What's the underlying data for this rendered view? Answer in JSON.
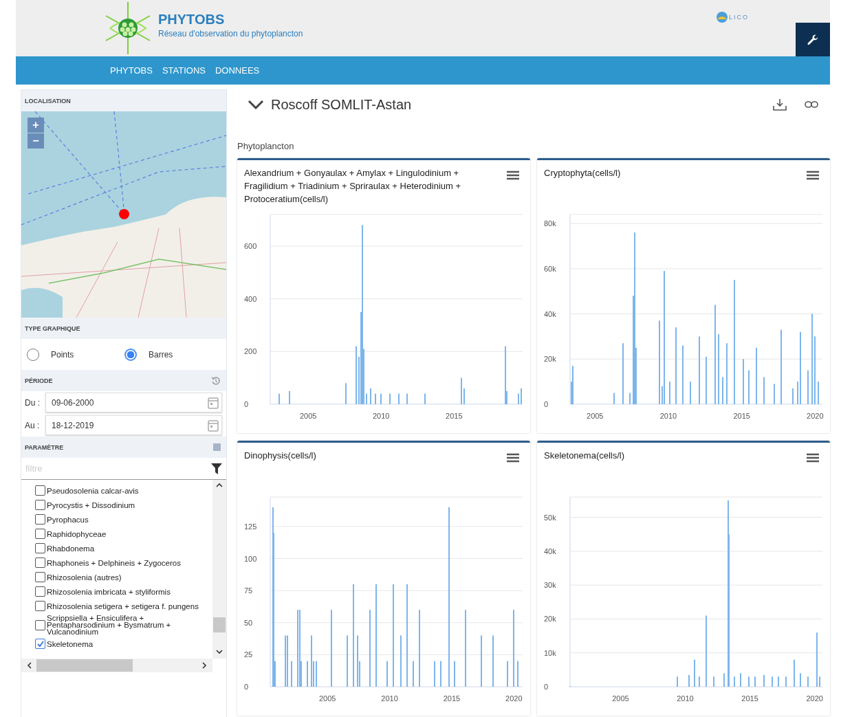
{
  "header": {
    "title": "PHYTOBS",
    "subtitle": "Réseau d'observation du phytoplancton",
    "partner_logo_text": "LICO"
  },
  "nav": [
    "PHYTOBS",
    "STATIONS",
    "DONNEES"
  ],
  "sidebar": {
    "location": {
      "heading": "LOCALISATION",
      "zoom_in": "+",
      "zoom_out": "−"
    },
    "chart_type": {
      "heading": "TYPE GRAPHIQUE",
      "options": [
        {
          "label": "Points",
          "selected": false
        },
        {
          "label": "Barres",
          "selected": true
        }
      ]
    },
    "period": {
      "heading": "PÉRIODE",
      "from": {
        "label": "Du :",
        "value": "09-06-2000"
      },
      "to": {
        "label": "Au :",
        "value": "18-12-2019"
      }
    },
    "parameter": {
      "heading": "PARAMÈTRE",
      "filter_placeholder": "filtre",
      "items": [
        {
          "label": "Pseudosolenia calcar-avis",
          "checked": false
        },
        {
          "label": "Pyrocystis + Dissodinium",
          "checked": false
        },
        {
          "label": "Pyrophacus",
          "checked": false
        },
        {
          "label": "Raphidophyceae",
          "checked": false
        },
        {
          "label": "Rhabdonema",
          "checked": false
        },
        {
          "label": "Rhaphoneis + Delphineis + Zygoceros",
          "checked": false
        },
        {
          "label": "Rhizosolenia (autres)",
          "checked": false
        },
        {
          "label": "Rhizosolenia imbricata + styliformis",
          "checked": false
        },
        {
          "label": "Rhizosolenia setigera + setigera f. pungens",
          "checked": false
        },
        {
          "label": "Scrippsiella + Ensiculifera + Pentapharsodinium + Bysmatrum + Vulcanodinium",
          "checked": false
        },
        {
          "label": "Skeletonema",
          "checked": true
        }
      ]
    }
  },
  "station": {
    "title": "Roscoff SOMLIT-Astan"
  },
  "section": "Phytoplancton",
  "charts": [
    {
      "title": "Alexandrium + Gonyaulax + Amylax + Lingulodinium + Fragilidium + Triadinium + Spriraulax + Heterodinium + Protoceratium(cells/l)",
      "chart_data": {
        "type": "bar",
        "x": [
          2003.0,
          2003.7,
          2007.6,
          2008.3,
          2008.5,
          2008.6,
          2008.7,
          2008.8,
          2009.0,
          2009.3,
          2009.6,
          2010.0,
          2010.6,
          2011.2,
          2011.8,
          2013.0,
          2015.5,
          2015.7,
          2018.5,
          2018.6,
          2019.4,
          2019.6
        ],
        "values": [
          40,
          50,
          80,
          220,
          180,
          350,
          680,
          210,
          40,
          60,
          40,
          40,
          40,
          40,
          40,
          40,
          100,
          60,
          220,
          50,
          40,
          60
        ],
        "xlim": [
          2002.4,
          2019.7
        ],
        "ylim": [
          0,
          720
        ],
        "grid": true,
        "xticks": [
          2005,
          2010,
          2015
        ],
        "yticks": [
          0,
          200,
          400,
          600
        ]
      }
    },
    {
      "title": "Cryptophyta(cells/l)",
      "chart_data": {
        "type": "bar",
        "x": [
          2003.4,
          2003.5,
          2006.3,
          2006.9,
          2007.4,
          2007.6,
          2007.7,
          2007.8,
          2009.4,
          2009.6,
          2009.7,
          2010.1,
          2010.5,
          2011.0,
          2011.5,
          2012.1,
          2012.6,
          2013.2,
          2013.4,
          2013.7,
          2014.0,
          2014.5,
          2015.1,
          2015.5,
          2016.0,
          2016.5,
          2017.2,
          2017.7,
          2018.5,
          2018.8,
          2019.0,
          2019.5,
          2019.8,
          2020.0,
          2020.2
        ],
        "values": [
          10000,
          17000,
          5000,
          27000,
          5000,
          48000,
          76000,
          25000,
          37000,
          8000,
          59000,
          10000,
          34000,
          26000,
          10000,
          30000,
          21000,
          44000,
          31000,
          12000,
          27000,
          55000,
          20000,
          15000,
          25000,
          12000,
          9000,
          33000,
          7000,
          10000,
          32000,
          15000,
          40000,
          30000,
          10000
        ],
        "xlim": [
          2003.3,
          2020.5
        ],
        "ylim": [
          0,
          84000
        ],
        "grid": true,
        "xticks": [
          2005,
          2010,
          2015,
          2020
        ],
        "yticks": [
          {
            "value": 0,
            "label": "0"
          },
          {
            "value": 20000,
            "label": "20k"
          },
          {
            "value": 40000,
            "label": "40k"
          },
          {
            "value": 60000,
            "label": "60k"
          },
          {
            "value": 80000,
            "label": "80k"
          }
        ]
      }
    },
    {
      "title": "Dinophysis(cells/l)",
      "chart_data": {
        "type": "bar",
        "x": [
          2000.6,
          2000.7,
          2000.8,
          2001.6,
          2001.8,
          2002.1,
          2002.6,
          2002.8,
          2002.9,
          2003.4,
          2003.7,
          2003.9,
          2004.1,
          2005.3,
          2006.6,
          2007.1,
          2007.4,
          2007.6,
          2008.4,
          2008.9,
          2009.8,
          2010.3,
          2010.9,
          2011.4,
          2011.9,
          2012.4,
          2013.6,
          2014.1,
          2014.8,
          2015.2,
          2016.1,
          2017.4,
          2018.3,
          2019.5,
          2020.0,
          2020.3
        ],
        "values": [
          140,
          120,
          20,
          40,
          40,
          20,
          60,
          60,
          20,
          20,
          40,
          20,
          20,
          60,
          40,
          80,
          40,
          20,
          60,
          80,
          20,
          80,
          40,
          80,
          20,
          60,
          20,
          20,
          140,
          20,
          60,
          40,
          40,
          20,
          60,
          20
        ],
        "xlim": [
          2000.4,
          2020.7
        ],
        "ylim": [
          0,
          148
        ],
        "grid": true,
        "xticks": [
          2005,
          2010,
          2015,
          2020
        ],
        "yticks": [
          0,
          25,
          50,
          75,
          100,
          125
        ]
      }
    },
    {
      "title": "Skeletonema(cells/l)",
      "chart_data": {
        "type": "bar",
        "x": [
          2001.1,
          2005.1,
          2009.4,
          2010.3,
          2010.7,
          2011.1,
          2011.6,
          2012.2,
          2013.0,
          2013.3,
          2013.4,
          2013.8,
          2014.3,
          2014.9,
          2015.4,
          2016.1,
          2016.7,
          2017.2,
          2017.8,
          2018.4,
          2018.9,
          2019.5,
          2020.2,
          2020.4
        ],
        "values": [
          200,
          null,
          3000,
          3500,
          8000,
          3000,
          21000,
          3000,
          4000,
          55000,
          45000,
          3000,
          4000,
          3000,
          3000,
          3500,
          3000,
          3000,
          3000,
          8000,
          4000,
          3000,
          16000,
          3000
        ],
        "xlim": [
          2001.1,
          2020.6
        ],
        "ylim": [
          0,
          56000
        ],
        "grid": true,
        "xticks": [
          2005,
          2010,
          2015,
          2020
        ],
        "yticks": [
          {
            "value": 0,
            "label": "0"
          },
          {
            "value": 10000,
            "label": "10k"
          },
          {
            "value": 20000,
            "label": "20k"
          },
          {
            "value": 30000,
            "label": "30k"
          },
          {
            "value": 40000,
            "label": "40k"
          },
          {
            "value": 50000,
            "label": "50k"
          }
        ]
      }
    }
  ]
}
